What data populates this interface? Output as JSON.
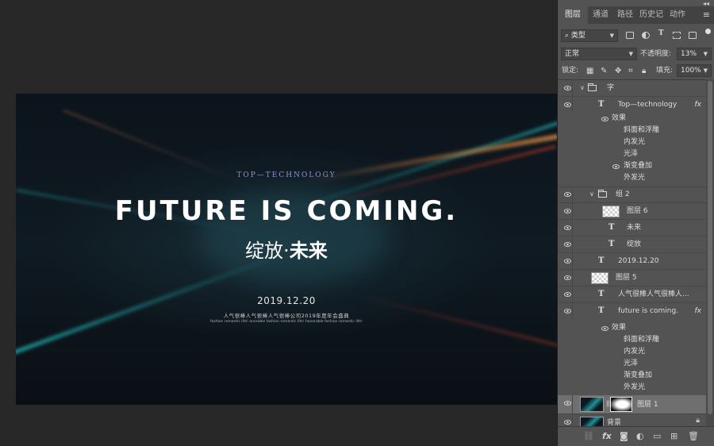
{
  "poster": {
    "subtitle": "TOP—TECHNOLOGY",
    "title": "FUTURE IS COMING.",
    "cn_part1": "绽放·",
    "cn_part2": "未来",
    "date": "2019.12.20",
    "tagline": "人气很棒人气很棒人气很棒公司2019年度年会盛典",
    "fine_print": "fashion romantic life! anorable fashion romantic life! honorable fashion romantic life!"
  },
  "panel": {
    "tabs": [
      "图层",
      "通道",
      "路径",
      "历史记",
      "动作"
    ],
    "active_tab": "图层",
    "filter_kind": "类型",
    "blend_mode": "正常",
    "opacity_label": "不透明度:",
    "opacity_value": "13%",
    "lock_label": "锁定:",
    "fill_label": "填充:",
    "fill_value": "100%"
  },
  "layers": {
    "group_zi": "字",
    "top_tech": "Top—technology",
    "effects_label": "效果",
    "fx_label": "fx",
    "effects1": [
      "斜面和浮雕",
      "内发光",
      "光泽",
      "渐变叠加",
      "外发光"
    ],
    "group2": "组 2",
    "layer6": "图层 6",
    "weilai": "未来",
    "zhanfang": "绽放",
    "date_layer": "2019.12.20",
    "layer5": "图层 5",
    "renqi": "人气很棒人气很棒人...",
    "future": "future is coming.",
    "effects2": [
      "斜面和浮雕",
      "内发光",
      "光泽",
      "渐变叠加",
      "外发光"
    ],
    "layer1": "图层 1",
    "background": "背景"
  },
  "colors": {
    "panel_bg": "#535353",
    "workspace_bg": "#282828",
    "accent_teal": "#1fa3a6",
    "accent_orange": "#e06a2a"
  }
}
